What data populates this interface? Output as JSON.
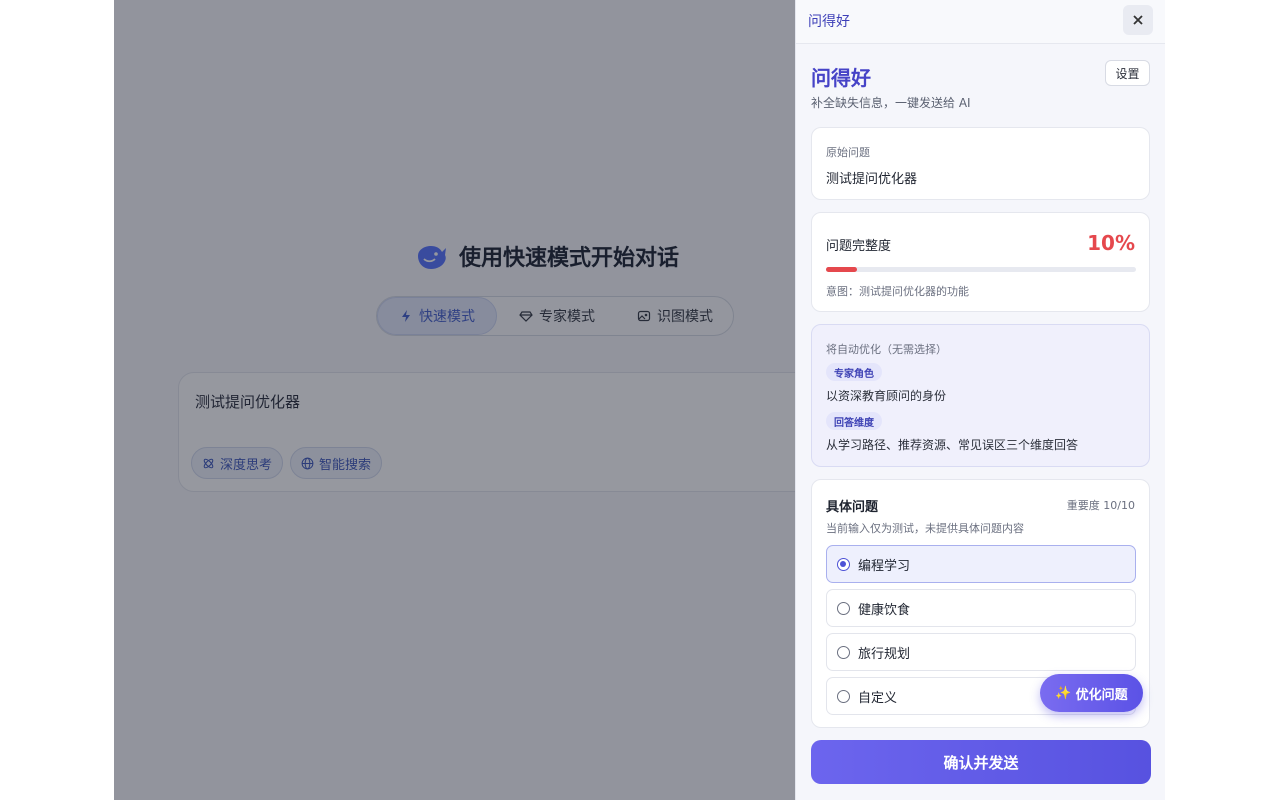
{
  "background_app": {
    "hero_title": "使用快速模式开始对话",
    "modes": [
      {
        "label": "快速模式",
        "icon": "lightning-icon",
        "active": true
      },
      {
        "label": "专家模式",
        "icon": "gem-icon",
        "active": false
      },
      {
        "label": "识图模式",
        "icon": "image-icon",
        "active": false
      }
    ],
    "input_text": "测试提问优化器",
    "chips": [
      {
        "label": "深度思考",
        "icon": "atom-icon"
      },
      {
        "label": "智能搜索",
        "icon": "globe-icon"
      }
    ]
  },
  "panel": {
    "header_title": "问得好",
    "close_icon": "close-icon",
    "brand_title": "问得好",
    "brand_subtitle": "补全缺失信息，一键发送给 AI",
    "settings_label": "设置",
    "original": {
      "label": "原始问题",
      "text": "测试提问优化器"
    },
    "completeness": {
      "label": "问题完整度",
      "percent_text": "10%",
      "percent": 10,
      "intent": "意图：测试提问优化器的功能"
    },
    "auto_optimize": {
      "label": "将自动优化（无需选择）",
      "items": [
        {
          "tag": "专家角色",
          "text": "以资深教育顾问的身份"
        },
        {
          "tag": "回答维度",
          "text": "从学习路径、推荐资源、常见误区三个维度回答"
        }
      ]
    },
    "specific": {
      "title": "具体问题",
      "importance": "重要度 10/10",
      "desc": "当前输入仅为测试，未提供具体问题内容",
      "options": [
        {
          "label": "编程学习",
          "selected": true
        },
        {
          "label": "健康饮食",
          "selected": false
        },
        {
          "label": "旅行规划",
          "selected": false
        },
        {
          "label": "自定义",
          "selected": false
        }
      ]
    },
    "float_button": {
      "icon": "sparkle-icon",
      "label": "优化问题"
    },
    "confirm_label": "确认并发送"
  },
  "colors": {
    "accent": "#4643c7",
    "danger": "#e5484d",
    "active_mode": "#3a57c9"
  }
}
